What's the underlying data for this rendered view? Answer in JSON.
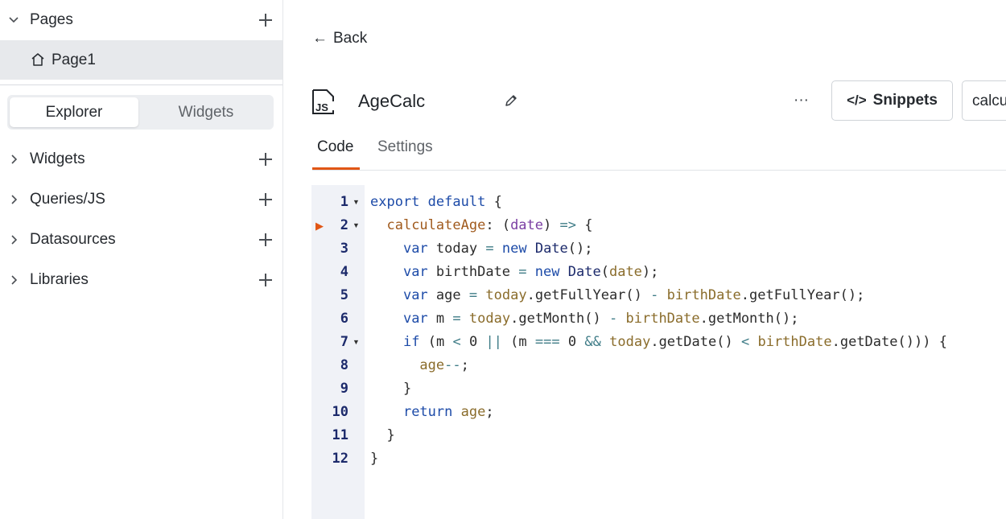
{
  "sidebar": {
    "pages_title": "Pages",
    "page_item": "Page1",
    "tabs": {
      "explorer": "Explorer",
      "widgets": "Widgets"
    },
    "tree": [
      {
        "label": "Widgets"
      },
      {
        "label": "Queries/JS"
      },
      {
        "label": "Datasources"
      },
      {
        "label": "Libraries"
      }
    ]
  },
  "main": {
    "back_label": "Back",
    "object_name": "AgeCalc",
    "more_label": "···",
    "snippets_label": "Snippets",
    "function_select_value": "calcu",
    "tabs": {
      "code": "Code",
      "settings": "Settings"
    }
  },
  "editor": {
    "line_numbers": [
      "1",
      "2",
      "3",
      "4",
      "5",
      "6",
      "7",
      "8",
      "9",
      "10",
      "11",
      "12"
    ],
    "lines": [
      "export default {",
      "  calculateAge: (date) => {",
      "    var today = new Date();",
      "    var birthDate = new Date(date);",
      "    var age = today.getFullYear() - birthDate.getFullYear();",
      "    var m = today.getMonth() - birthDate.getMonth();",
      "    if (m < 0 || (m === 0 && today.getDate() < birthDate.getDate())) {",
      "      age--;",
      "    }",
      "    return age;",
      "  }",
      "}"
    ]
  },
  "colors": {
    "accent": "#e15615",
    "keyword": "#1d4ba8",
    "gutter_bg": "#f0f2f7"
  }
}
